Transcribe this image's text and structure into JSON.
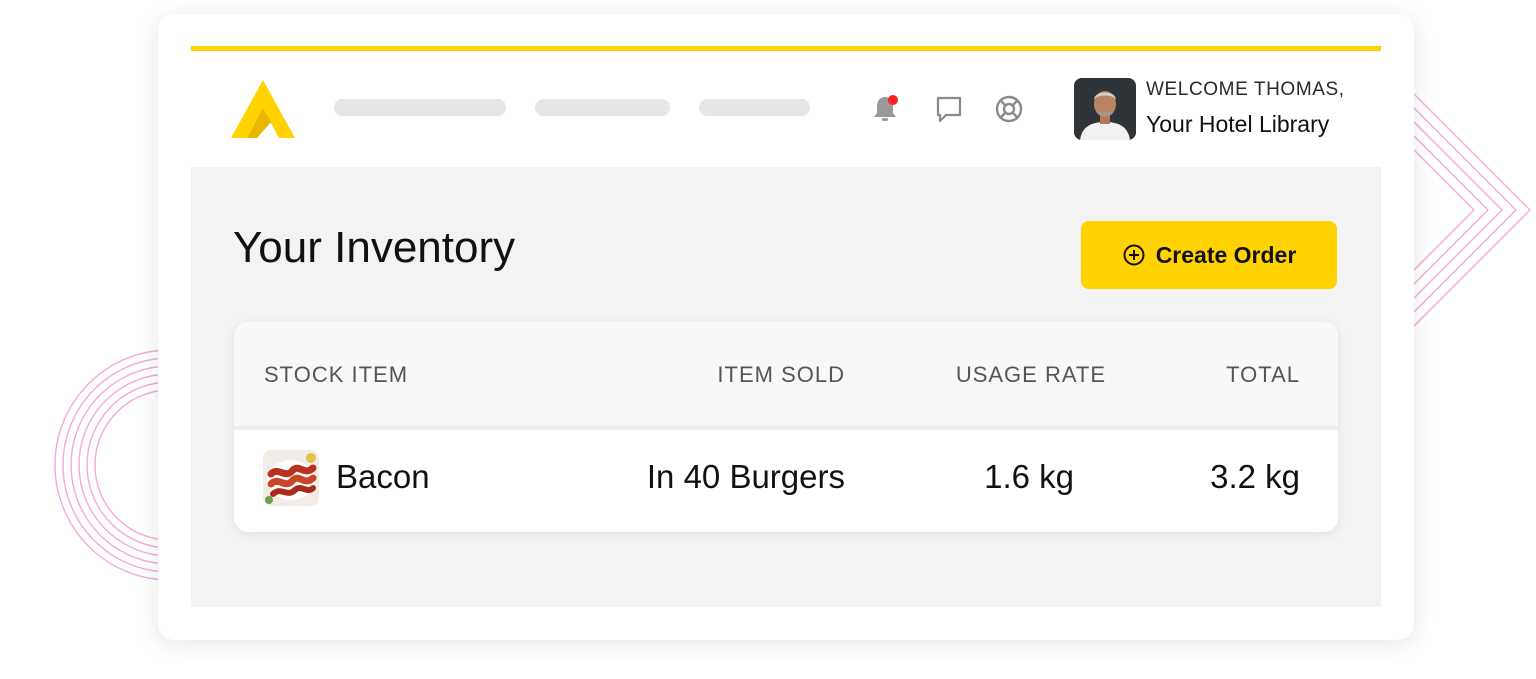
{
  "colors": {
    "accent": "#ffd200",
    "notification_dot": "#ff1f1f",
    "decor_pink": "#f39ad6"
  },
  "header": {
    "logo_icon": "brand-logo-a",
    "icons": [
      "bell-icon",
      "chat-icon",
      "help-icon"
    ],
    "welcome": "WELCOME THOMAS,",
    "subtitle": "Your Hotel Library"
  },
  "main": {
    "title": "Your Inventory",
    "create_order_label": "Create Order",
    "create_order_icon": "plus-circle-icon"
  },
  "table": {
    "columns": [
      "STOCK ITEM",
      "ITEM SOLD",
      "USAGE RATE",
      "TOTAL"
    ],
    "rows": [
      {
        "item": "Bacon",
        "sold": "In 40 Burgers",
        "usage_rate": "1.6 kg",
        "total": "3.2 kg"
      }
    ]
  }
}
